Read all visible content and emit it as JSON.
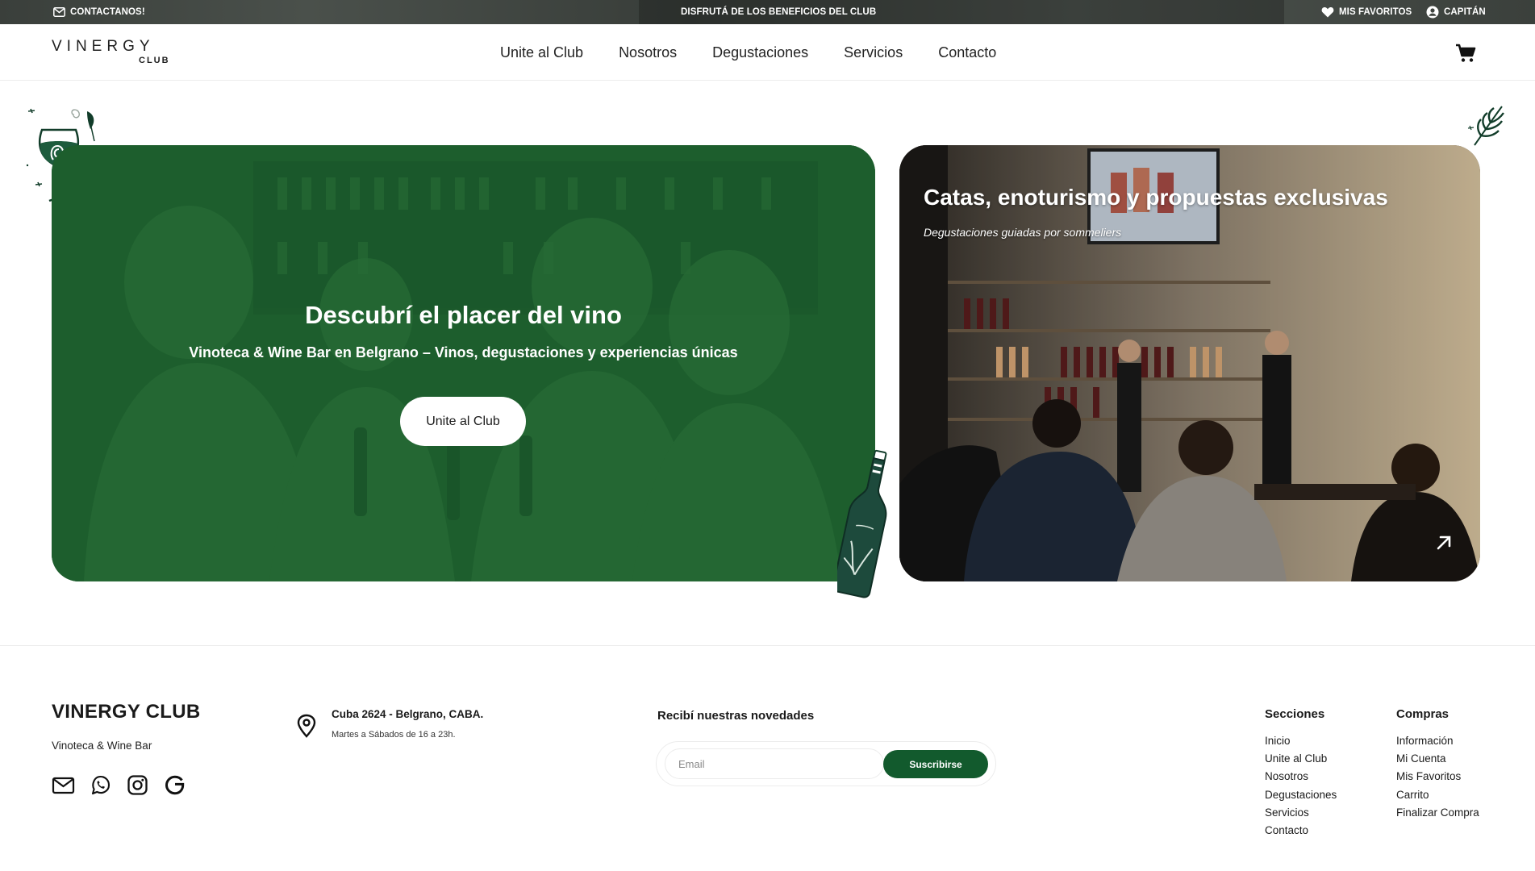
{
  "topbar": {
    "contact_label": "CONTACTANOS!",
    "promo_label": "DISFRUTÁ DE LOS BENEFICIOS DEL CLUB",
    "favorites_label": "MIS FAVORITOS",
    "account_label": "CAPITÁN"
  },
  "header": {
    "logo_word": "VINERGY",
    "logo_sub": "CLUB",
    "nav": [
      "Unite al Club",
      "Nosotros",
      "Degustaciones",
      "Servicios",
      "Contacto"
    ],
    "cart_icon": "cart-icon"
  },
  "hero": {
    "title": "Descubrí el placer del vino",
    "subtitle": "Vinoteca & Wine Bar en Belgrano – Vinos, degustaciones y experiencias únicas",
    "cta": "Unite al Club",
    "overlay_color": "#1e5e2d"
  },
  "promo": {
    "title": "Catas, enoturismo y propuestas exclusivas",
    "subtitle": "Degustaciones guiadas por sommeliers",
    "arrow_icon": "arrow-up-right-icon"
  },
  "footer": {
    "brand": "VINERGY CLUB",
    "tagline": "Vinoteca & Wine Bar",
    "social": [
      "mail-icon",
      "whatsapp-icon",
      "instagram-icon",
      "google-icon"
    ],
    "address": "Cuba 2624 - Belgrano, CABA.",
    "hours": "Martes a Sábados de 16 a 23h.",
    "newsletter": {
      "title": "Recibí nuestras novedades",
      "placeholder": "Email",
      "button": "Suscribirse",
      "button_color": "#125a2d"
    },
    "columns": [
      {
        "title": "Secciones",
        "links": [
          "Inicio",
          "Unite al Club",
          "Nosotros",
          "Degustaciones",
          "Servicios",
          "Contacto"
        ]
      },
      {
        "title": "Compras",
        "links": [
          "Información",
          "Mi Cuenta",
          "Mis Favoritos",
          "Carrito",
          "Finalizar Compra"
        ]
      }
    ]
  }
}
